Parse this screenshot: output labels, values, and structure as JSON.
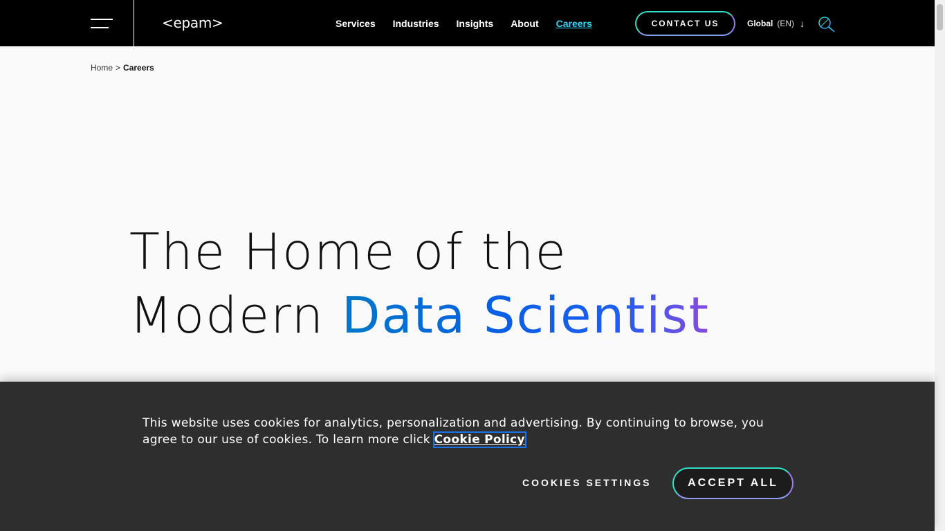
{
  "header": {
    "logo": "<epam>",
    "nav": [
      {
        "label": "Services"
      },
      {
        "label": "Industries"
      },
      {
        "label": "Insights"
      },
      {
        "label": "About"
      },
      {
        "label": "Careers",
        "active": true
      }
    ],
    "contact_label": "CONTACT US",
    "global_label": "Global",
    "global_lang": "(EN)",
    "global_arrow": "↓"
  },
  "breadcrumb": {
    "home": "Home",
    "separator": ">",
    "current": "Careers"
  },
  "hero": {
    "line1": "The Home of the",
    "line2_plain": "Modern ",
    "line2_highlight": "Data Scientist"
  },
  "cookie": {
    "text": "This website uses cookies for analytics, personalization and advertising. By continuing to browse, you agree to our use of cookies. To learn more click ",
    "policy_link": "Cookie Policy",
    "settings_label": "COOKIES SETTINGS",
    "accept_label": "ACCEPT ALL"
  },
  "colors": {
    "accent_cyan": "#2fdaf5",
    "accent_teal": "#2fe0c6",
    "accent_purple": "#9b7cf0",
    "header_bg": "#000000",
    "banner_bg": "#2e2e2e"
  }
}
